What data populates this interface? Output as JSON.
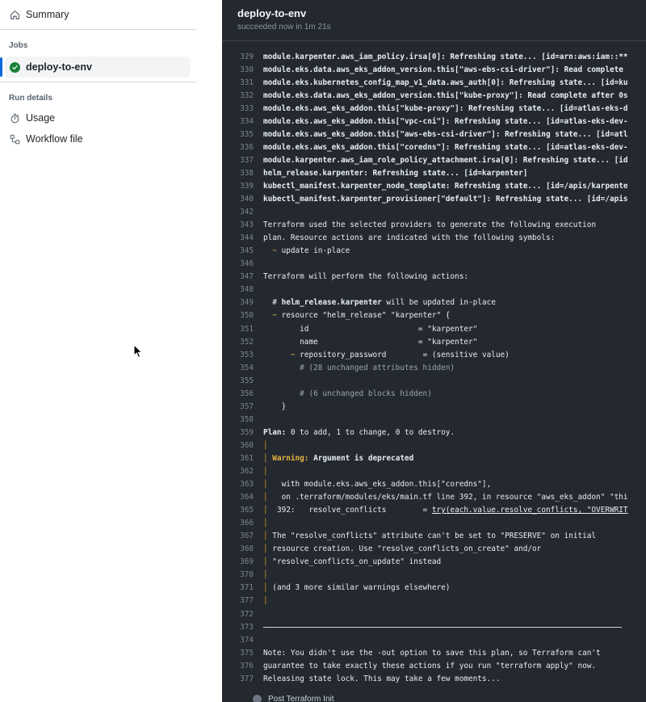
{
  "sidebar": {
    "summary_label": "Summary",
    "jobs_heading": "Jobs",
    "active_job_label": "deploy-to-env",
    "run_details_heading": "Run details",
    "usage_label": "Usage",
    "workflow_file_label": "Workflow file"
  },
  "job": {
    "title": "deploy-to-env",
    "status": "succeeded now in 1m 21s"
  },
  "colors": {
    "success": "#1a7f37",
    "accent": "#0969da",
    "log_background": "#24292f",
    "warning": "#e3b341"
  },
  "icons": [
    "home-icon",
    "check-circle-icon",
    "stopwatch-icon",
    "workflow-file-icon",
    "mouse-cursor-icon"
  ],
  "log_lines": [
    {
      "n": "329",
      "t": "module.karpenter.aws_iam_policy.irsa[0]: Refreshing state... [id=arn:aws:iam::**",
      "k": "bold"
    },
    {
      "n": "330",
      "t": "module.eks.data.aws_eks_addon_version.this[\"aws-ebs-csi-driver\"]: Read complete",
      "k": "bold"
    },
    {
      "n": "331",
      "t": "module.eks.kubernetes_config_map_v1_data.aws_auth[0]: Refreshing state... [id=ku",
      "k": "bold"
    },
    {
      "n": "332",
      "t": "module.eks.data.aws_eks_addon_version.this[\"kube-proxy\"]: Read complete after 0s",
      "k": "bold"
    },
    {
      "n": "333",
      "t": "module.eks.aws_eks_addon.this[\"kube-proxy\"]: Refreshing state... [id=atlas-eks-d",
      "k": "bold"
    },
    {
      "n": "334",
      "t": "module.eks.aws_eks_addon.this[\"vpc-cni\"]: Refreshing state... [id=atlas-eks-dev-",
      "k": "bold"
    },
    {
      "n": "335",
      "t": "module.eks.aws_eks_addon.this[\"aws-ebs-csi-driver\"]: Refreshing state... [id=atl",
      "k": "bold"
    },
    {
      "n": "336",
      "t": "module.eks.aws_eks_addon.this[\"coredns\"]: Refreshing state... [id=atlas-eks-dev-",
      "k": "bold"
    },
    {
      "n": "337",
      "t": "module.karpenter.aws_iam_role_policy_attachment.irsa[0]: Refreshing state... [id",
      "k": "bold"
    },
    {
      "n": "338",
      "t": "helm_release.karpenter: Refreshing state... [id=karpenter]",
      "k": "bold"
    },
    {
      "n": "339",
      "t": "kubectl_manifest.karpenter_node_template: Refreshing state... [id=/apis/karpente",
      "k": "bold"
    },
    {
      "n": "340",
      "t": "kubectl_manifest.karpenter_provisioner[\"default\"]: Refreshing state... [id=/apis",
      "k": "bold"
    },
    {
      "n": "342",
      "t": "",
      "k": "plain"
    },
    {
      "n": "343",
      "t": "Terraform used the selected providers to generate the following execution",
      "k": "plain"
    },
    {
      "n": "344",
      "t": "plan. Resource actions are indicated with the following symbols:",
      "k": "plain"
    },
    {
      "n": "345",
      "t": "~",
      "t2": " update in-place",
      "k": "tilde2"
    },
    {
      "n": "346",
      "t": "",
      "k": "plain"
    },
    {
      "n": "347",
      "t": "Terraform will perform the following actions:",
      "k": "plain"
    },
    {
      "n": "348",
      "t": "",
      "k": "plain"
    },
    {
      "n": "349",
      "pre": "  # ",
      "b": "helm_release.karpenter",
      "post": " will be updated in-place",
      "k": "mixed"
    },
    {
      "n": "350",
      "t": "~",
      "t2": " resource \"helm_release\" \"karpenter\" {",
      "k": "tilde2"
    },
    {
      "n": "351",
      "t": "        id                        = \"karpenter\"",
      "k": "plain"
    },
    {
      "n": "352",
      "t": "        name                      = \"karpenter\"",
      "k": "plain"
    },
    {
      "n": "353",
      "t": "~",
      "t2": " repository_password        = (sensitive value)",
      "k": "tilde6"
    },
    {
      "n": "354",
      "t": "        # (28 unchanged attributes hidden)",
      "k": "muted"
    },
    {
      "n": "355",
      "t": "",
      "k": "plain"
    },
    {
      "n": "356",
      "t": "        # (6 unchanged blocks hidden)",
      "k": "muted"
    },
    {
      "n": "357",
      "t": "    }",
      "k": "plain"
    },
    {
      "n": "358",
      "t": "",
      "k": "plain"
    },
    {
      "n": "359",
      "pre": "",
      "b": "Plan:",
      "post": " 0 to add, 1 to change, 0 to destroy.",
      "k": "mixed"
    },
    {
      "n": "360",
      "t": "",
      "k": "pipe"
    },
    {
      "n": "361",
      "w": "Warning:",
      "b": " Argument is deprecated",
      "k": "warn"
    },
    {
      "n": "362",
      "t": "",
      "k": "pipe"
    },
    {
      "n": "363",
      "t": "  with module.eks.aws_eks_addon.this[\"coredns\"],",
      "k": "pipe"
    },
    {
      "n": "364",
      "t": "  on .terraform/modules/eks/main.tf line 392, in resource \"aws_eks_addon\" \"thi",
      "k": "pipe"
    },
    {
      "n": "365",
      "t": " 392:   resolve_conflicts        = ",
      "u": "try(each.value.resolve_conflicts, \"OVERWRIT",
      "k": "pipeul"
    },
    {
      "n": "366",
      "t": "",
      "k": "pipe"
    },
    {
      "n": "367",
      "t": "The \"resolve_conflicts\" attribute can't be set to \"PRESERVE\" on initial",
      "k": "pipe"
    },
    {
      "n": "368",
      "t": "resource creation. Use \"resolve_conflicts_on_create\" and/or",
      "k": "pipe"
    },
    {
      "n": "369",
      "t": "\"resolve_conflicts_on_update\" instead",
      "k": "pipe"
    },
    {
      "n": "370",
      "t": "",
      "k": "pipe"
    },
    {
      "n": "371",
      "t": "(and 3 more similar warnings elsewhere)",
      "k": "pipe"
    },
    {
      "n": "377",
      "t": "",
      "k": "pipe"
    },
    {
      "n": "372",
      "t": "",
      "k": "plain"
    },
    {
      "n": "373",
      "t": "",
      "k": "rule"
    },
    {
      "n": "374",
      "t": "",
      "k": "plain"
    },
    {
      "n": "375",
      "t": "Note: You didn't use the -out option to save this plan, so Terraform can't",
      "k": "plain"
    },
    {
      "n": "376",
      "t": "guarantee to take exactly these actions if you run \"terraform apply\" now.",
      "k": "plain"
    },
    {
      "n": "377",
      "t": "Releasing state lock. This may take a few moments...",
      "k": "plain"
    }
  ],
  "next_step_label": "Post Terraform Init"
}
